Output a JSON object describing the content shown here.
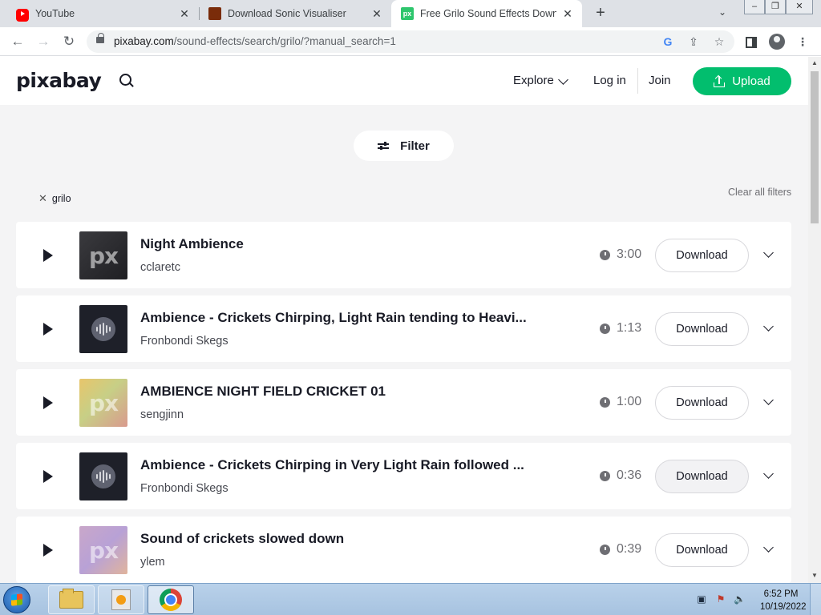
{
  "browser": {
    "tabs": [
      {
        "title": "YouTube",
        "icon": "youtube-icon",
        "active": false
      },
      {
        "title": "Download Sonic Visualiser",
        "icon": "sonic-visualiser-icon",
        "active": false
      },
      {
        "title": "Free Grilo Sound Effects Downlo",
        "icon": "pixabay-icon",
        "active": true
      }
    ],
    "new_tab_label": "+",
    "url_host": "pixabay.com",
    "url_path": "/sound-effects/search/grilo/?manual_search=1"
  },
  "site": {
    "logo": "pixabay",
    "nav": {
      "explore": "Explore",
      "login": "Log in",
      "join": "Join",
      "upload": "Upload"
    },
    "filter_label": "Filter",
    "active_filter": "grilo",
    "clear_filters": "Clear all filters",
    "accent_color": "#02be6e",
    "download_label": "Download",
    "results": [
      {
        "title": "Night Ambience",
        "author": "cclaretc",
        "duration": "3:00",
        "thumb": "pixabay-grey"
      },
      {
        "title": "Ambience - Crickets Chirping, Light Rain tending to Heavi...",
        "author": "Fronbondi Skegs",
        "duration": "1:13",
        "thumb": "waveform-dark"
      },
      {
        "title": "AMBIENCE NIGHT FIELD CRICKET 01",
        "author": "sengjinn",
        "duration": "1:00",
        "thumb": "pixabay-gradient-yellow"
      },
      {
        "title": "Ambience - Crickets Chirping in Very Light Rain followed ...",
        "author": "Fronbondi Skegs",
        "duration": "0:36",
        "thumb": "waveform-dark"
      },
      {
        "title": "Sound of crickets slowed down",
        "author": "ylem",
        "duration": "0:39",
        "thumb": "pixabay-gradient-purple"
      }
    ]
  },
  "taskbar": {
    "time": "6:52 PM",
    "date": "10/19/2022"
  }
}
